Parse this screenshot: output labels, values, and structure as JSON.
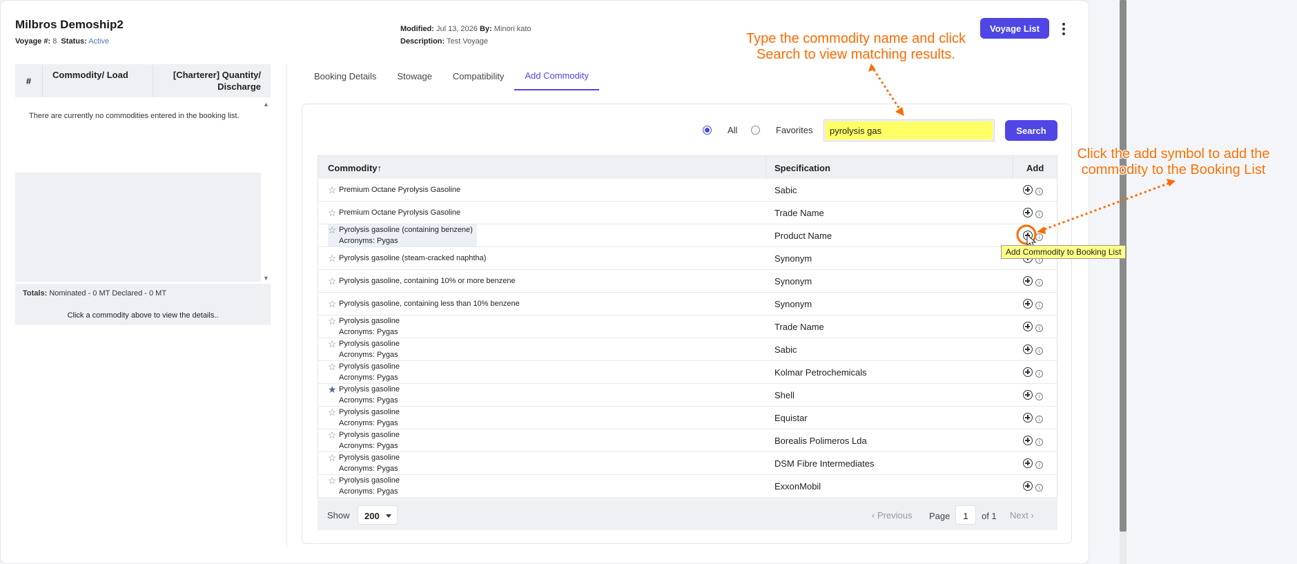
{
  "header": {
    "title": "Milbros Demoship2",
    "voyage_label": "Voyage #:",
    "voyage_value": "8",
    "status_label": "Status:",
    "status_value": "Active",
    "modified_label": "Modified:",
    "modified_value": "Jul 13, 2026",
    "by_label": "By:",
    "by_value": "Minori kato",
    "description_label": "Description:",
    "description_value": "Test Voyage",
    "voyage_list_button": "Voyage List"
  },
  "left_panel": {
    "col_num": "#",
    "col_commodity": "Commodity/ Load",
    "col_quantity": "[Charterer] Quantity/ Discharge",
    "empty_message": "There are currently no commodities entered in the booking list.",
    "totals_label": "Totals:",
    "totals_value": "Nominated - 0 MT Declared - 0 MT",
    "click_hint": "Click a commodity above to view the details.."
  },
  "tabs": [
    {
      "label": "Booking Details",
      "active": false
    },
    {
      "label": "Stowage",
      "active": false
    },
    {
      "label": "Compatibility",
      "active": false
    },
    {
      "label": "Add Commodity",
      "active": true
    }
  ],
  "search": {
    "radio_all": "All",
    "radio_favorites": "Favorites",
    "selected": "All",
    "query": "pyrolysis gas",
    "button": "Search"
  },
  "table": {
    "headers": {
      "commodity": "Commodity↑",
      "specification": "Specification",
      "add": "Add"
    },
    "rows": [
      {
        "commodity": "Premium Octane Pyrolysis Gasoline",
        "acronyms": "",
        "specification": "Sabic",
        "favorite": false
      },
      {
        "commodity": "Premium Octane Pyrolysis Gasoline",
        "acronyms": "",
        "specification": "Trade Name",
        "favorite": false
      },
      {
        "commodity": "Pyrolysis gasoline (containing benzene)",
        "acronyms": "Acronyms: Pygas",
        "specification": "Product Name",
        "favorite": false,
        "highlighted": true
      },
      {
        "commodity": "Pyrolysis gasoline (steam-cracked naphtha)",
        "acronyms": "",
        "specification": "Synonym",
        "favorite": false
      },
      {
        "commodity": "Pyrolysis gasoline, containing 10% or more benzene",
        "acronyms": "",
        "specification": "Synonym",
        "favorite": false
      },
      {
        "commodity": "Pyrolysis gasoline, containing less than 10% benzene",
        "acronyms": "",
        "specification": "Synonym",
        "favorite": false
      },
      {
        "commodity": "Pyrolysis gasoline",
        "acronyms": "Acronyms: Pygas",
        "specification": "Trade Name",
        "favorite": false
      },
      {
        "commodity": "Pyrolysis gasoline",
        "acronyms": "Acronyms: Pygas",
        "specification": "Sabic",
        "favorite": false
      },
      {
        "commodity": "Pyrolysis gasoline",
        "acronyms": "Acronyms: Pygas",
        "specification": "Kolmar Petrochemicals",
        "favorite": false
      },
      {
        "commodity": "Pyrolysis gasoline",
        "acronyms": "Acronyms: Pygas",
        "specification": "Shell",
        "favorite": true
      },
      {
        "commodity": "Pyrolysis gasoline",
        "acronyms": "Acronyms: Pygas",
        "specification": "Equistar",
        "favorite": false
      },
      {
        "commodity": "Pyrolysis gasoline",
        "acronyms": "Acronyms: Pygas",
        "specification": "Borealis Polimeros Lda",
        "favorite": false
      },
      {
        "commodity": "Pyrolysis gasoline",
        "acronyms": "Acronyms: Pygas",
        "specification": "DSM Fibre Intermediates",
        "favorite": false
      },
      {
        "commodity": "Pyrolysis gasoline",
        "acronyms": "Acronyms: Pygas",
        "specification": "ExxonMobil",
        "favorite": false
      }
    ]
  },
  "pagination": {
    "show_label": "Show",
    "page_size": "200",
    "previous": "‹ Previous",
    "page_label": "Page",
    "page": "1",
    "of_label": "of 1",
    "next": "Next ›"
  },
  "annotations": {
    "callout_search": "Type the commodity name and click Search to view matching results.",
    "callout_add": "Click the add symbol to add the commodity to the Booking List",
    "tooltip": "Add Commodity to Booking List",
    "accent_color": "#ff6a00"
  },
  "colors": {
    "primary": "#4f46e5",
    "search_highlight": "#ffff66",
    "tooltip_bg": "#ffff88"
  }
}
